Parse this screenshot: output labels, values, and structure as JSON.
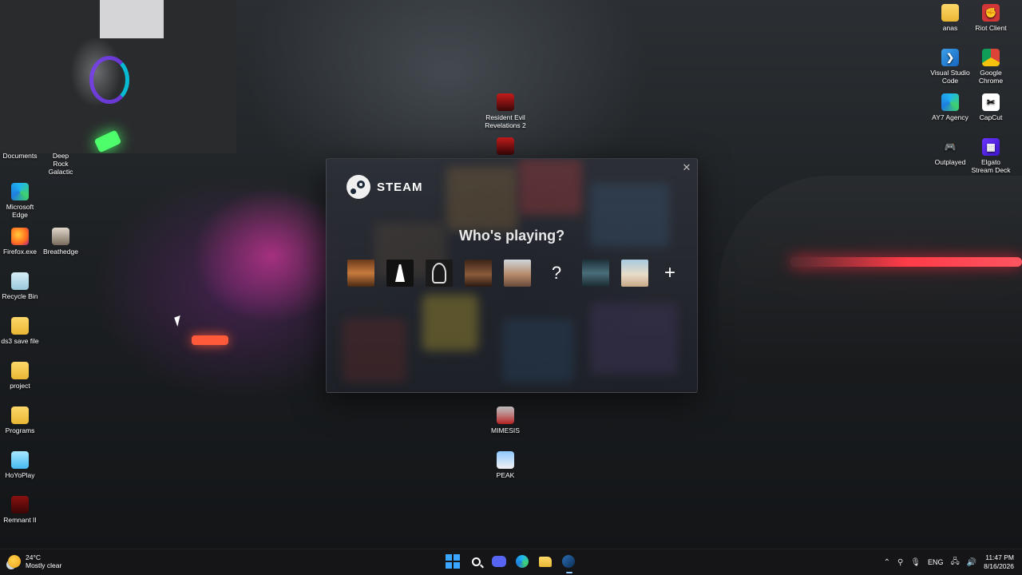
{
  "desktop_icons_left": [
    {
      "label": "Documents",
      "icon": "folder-icon"
    },
    {
      "label": "Deep Rock Galactic",
      "icon": "deep-rock-galactic-icon"
    },
    {
      "label": "Microsoft Edge",
      "icon": "edge-icon"
    },
    {
      "label": "Firefox.exe",
      "icon": "firefox-icon"
    },
    {
      "label": "Breathedge",
      "icon": "breathedge-icon"
    },
    {
      "label": "Recycle Bin",
      "icon": "recycle-bin-icon"
    },
    {
      "label": "ds3 save file",
      "icon": "folder-icon"
    },
    {
      "label": "project",
      "icon": "folder-icon"
    },
    {
      "label": "Programs",
      "icon": "folder-icon"
    },
    {
      "label": "HoYoPlay",
      "icon": "hoyoplay-icon"
    },
    {
      "label": "Remnant II",
      "icon": "remnant-icon"
    }
  ],
  "desktop_icons_center": [
    {
      "label": "Resident Evil Revelations 2",
      "icon": "game-icon"
    },
    {
      "label": "MIMESIS",
      "icon": "mimesis-icon"
    },
    {
      "label": "PEAK",
      "icon": "peak-icon"
    }
  ],
  "desktop_icons_right": [
    {
      "label": "anas",
      "icon": "folder-icon"
    },
    {
      "label": "Riot Client",
      "icon": "riot-icon"
    },
    {
      "label": "Visual Studio Code",
      "icon": "vscode-icon"
    },
    {
      "label": "Google Chrome",
      "icon": "chrome-icon"
    },
    {
      "label": "AY7 Agency",
      "icon": "edge-icon"
    },
    {
      "label": "CapCut",
      "icon": "capcut-icon"
    },
    {
      "label": "Outplayed",
      "icon": "outplayed-icon"
    },
    {
      "label": "Elgato Stream Deck",
      "icon": "elgato-icon"
    }
  ],
  "steam_dialog": {
    "brand": "STEAM",
    "title": "Who's playing?",
    "close_glyph": "✕",
    "unknown_avatar_glyph": "?",
    "add_glyph": "+"
  },
  "taskbar": {
    "weather_temp": "24°C",
    "weather_desc": "Mostly clear",
    "language": "ENG",
    "time": "11:47 PM",
    "date": "8/16/2026"
  },
  "colors": {
    "accent_blue": "#3aa6ff",
    "steam_dark": "#1b2838",
    "taillight_red": "#ff3b48"
  }
}
